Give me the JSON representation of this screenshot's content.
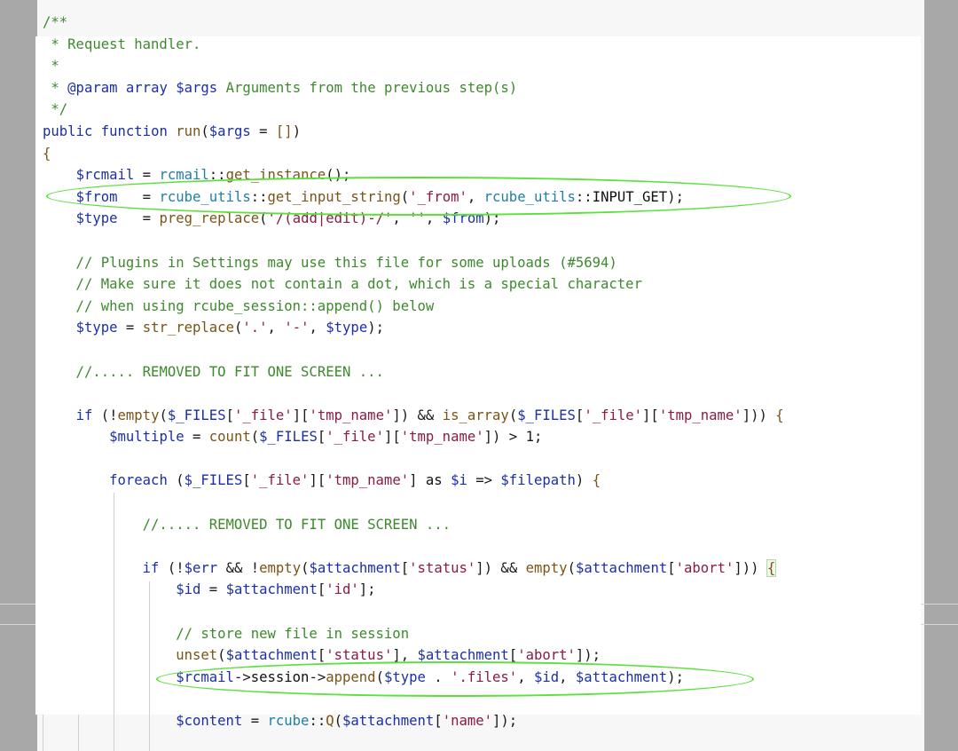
{
  "code_lines": [
    [
      [
        "c-cm",
        "/**"
      ]
    ],
    [
      [
        "c-cm",
        " * Request handler."
      ]
    ],
    [
      [
        "c-cm",
        " *"
      ]
    ],
    [
      [
        "c-cm",
        " * "
      ],
      [
        "c-kw",
        "@param"
      ],
      [
        "c-kw",
        " array"
      ],
      [
        "c-var",
        " $args"
      ],
      [
        "c-cm",
        " Arguments from the previous step(s)"
      ]
    ],
    [
      [
        "c-cm",
        " */"
      ]
    ],
    [
      [
        "c-kw",
        "public"
      ],
      [
        "c-p",
        " "
      ],
      [
        "c-kw",
        "function"
      ],
      [
        "c-p",
        " "
      ],
      [
        "c-fn",
        "run"
      ],
      [
        "c-p",
        "("
      ],
      [
        "c-var",
        "$args"
      ],
      [
        "c-p",
        " = "
      ],
      [
        "c-fn",
        "[]"
      ],
      [
        "c-p",
        ")"
      ]
    ],
    [
      [
        "c-fn",
        "{"
      ]
    ],
    [
      [
        "c-p",
        "    "
      ],
      [
        "c-var",
        "$rcmail"
      ],
      [
        "c-p",
        " = "
      ],
      [
        "c-cls",
        "rcmail"
      ],
      [
        "c-p",
        "::"
      ],
      [
        "c-fn",
        "get_instance"
      ],
      [
        "c-p",
        "();"
      ]
    ],
    [
      [
        "c-p",
        "    "
      ],
      [
        "c-var",
        "$from"
      ],
      [
        "c-p",
        "   = "
      ],
      [
        "c-cls",
        "rcube_utils"
      ],
      [
        "c-p",
        "::"
      ],
      [
        "c-fn",
        "get_input_string"
      ],
      [
        "c-p",
        "("
      ],
      [
        "c-str",
        "'_from'"
      ],
      [
        "c-p",
        ", "
      ],
      [
        "c-cls",
        "rcube_utils"
      ],
      [
        "c-p",
        "::"
      ],
      [
        "c-dark",
        "INPUT_GET"
      ],
      [
        "c-p",
        ");"
      ]
    ],
    [
      [
        "c-p",
        "    "
      ],
      [
        "c-var",
        "$type"
      ],
      [
        "c-p",
        "   = "
      ],
      [
        "c-fn",
        "preg_replace"
      ],
      [
        "c-p",
        "("
      ],
      [
        "c-str",
        "'/(add|edit)-/'"
      ],
      [
        "c-p",
        ", "
      ],
      [
        "c-str",
        "''"
      ],
      [
        "c-p",
        ", "
      ],
      [
        "c-var",
        "$from"
      ],
      [
        "c-p",
        ");"
      ]
    ],
    [
      [
        "c-p",
        ""
      ]
    ],
    [
      [
        "c-cm",
        "    // Plugins in Settings may use this file for some uploads (#5694)"
      ]
    ],
    [
      [
        "c-cm",
        "    // Make sure it does not contain a dot, which is a special character"
      ]
    ],
    [
      [
        "c-cm",
        "    // when using rcube_session::append() below"
      ]
    ],
    [
      [
        "c-p",
        "    "
      ],
      [
        "c-var",
        "$type"
      ],
      [
        "c-p",
        " = "
      ],
      [
        "c-fn",
        "str_replace"
      ],
      [
        "c-p",
        "("
      ],
      [
        "c-str",
        "'.'"
      ],
      [
        "c-p",
        ", "
      ],
      [
        "c-str",
        "'-'"
      ],
      [
        "c-p",
        ", "
      ],
      [
        "c-var",
        "$type"
      ],
      [
        "c-p",
        ");"
      ]
    ],
    [
      [
        "c-p",
        ""
      ]
    ],
    [
      [
        "c-cm",
        "    //..... "
      ],
      [
        "c-cm",
        "REMOVED TO FIT ONE SCREEN ..."
      ]
    ],
    [
      [
        "c-p",
        ""
      ]
    ],
    [
      [
        "c-p",
        "    "
      ],
      [
        "c-kw",
        "if"
      ],
      [
        "c-p",
        " (!"
      ],
      [
        "c-fn",
        "empty"
      ],
      [
        "c-p",
        "("
      ],
      [
        "c-var",
        "$_FILES"
      ],
      [
        "c-p",
        "["
      ],
      [
        "c-str",
        "'_file'"
      ],
      [
        "c-p",
        "]["
      ],
      [
        "c-str",
        "'tmp_name'"
      ],
      [
        "c-p",
        "]) && "
      ],
      [
        "c-fn",
        "is_array"
      ],
      [
        "c-p",
        "("
      ],
      [
        "c-var",
        "$_FILES"
      ],
      [
        "c-p",
        "["
      ],
      [
        "c-str",
        "'_file'"
      ],
      [
        "c-p",
        "]["
      ],
      [
        "c-str",
        "'tmp_name'"
      ],
      [
        "c-p",
        "])) "
      ],
      [
        "c-fn",
        "{"
      ]
    ],
    [
      [
        "c-p",
        "        "
      ],
      [
        "c-var",
        "$multiple"
      ],
      [
        "c-p",
        " = "
      ],
      [
        "c-fn",
        "count"
      ],
      [
        "c-p",
        "("
      ],
      [
        "c-var",
        "$_FILES"
      ],
      [
        "c-p",
        "["
      ],
      [
        "c-str",
        "'_file'"
      ],
      [
        "c-p",
        "]["
      ],
      [
        "c-str",
        "'tmp_name'"
      ],
      [
        "c-p",
        "]) > 1;"
      ]
    ],
    [
      [
        "c-p",
        ""
      ]
    ],
    [
      [
        "c-p",
        "        "
      ],
      [
        "c-kw",
        "foreach"
      ],
      [
        "c-p",
        " ("
      ],
      [
        "c-var",
        "$_FILES"
      ],
      [
        "c-p",
        "["
      ],
      [
        "c-str",
        "'_file'"
      ],
      [
        "c-p",
        "]["
      ],
      [
        "c-str",
        "'tmp_name'"
      ],
      [
        "c-p",
        "] "
      ],
      [
        "c-dark",
        "as"
      ],
      [
        "c-p",
        " "
      ],
      [
        "c-var",
        "$i"
      ],
      [
        "c-p",
        " => "
      ],
      [
        "c-var",
        "$filepath"
      ],
      [
        "c-p",
        ") "
      ],
      [
        "c-fn",
        "{"
      ]
    ],
    [
      [
        "c-p",
        ""
      ]
    ],
    [
      [
        "c-cm",
        "            //..... "
      ],
      [
        "c-cm",
        "REMOVED TO FIT ONE SCREEN ..."
      ]
    ],
    [
      [
        "c-p",
        ""
      ]
    ],
    [
      [
        "c-p",
        "            "
      ],
      [
        "c-kw",
        "if"
      ],
      [
        "c-p",
        " (!"
      ],
      [
        "c-var",
        "$err"
      ],
      [
        "c-p",
        " && !"
      ],
      [
        "c-fn",
        "empty"
      ],
      [
        "c-p",
        "("
      ],
      [
        "c-var",
        "$attachment"
      ],
      [
        "c-p",
        "["
      ],
      [
        "c-str",
        "'status'"
      ],
      [
        "c-p",
        "]) && "
      ],
      [
        "c-fn",
        "empty"
      ],
      [
        "c-p",
        "("
      ],
      [
        "c-var",
        "$attachment"
      ],
      [
        "c-p",
        "["
      ],
      [
        "c-str",
        "'abort'"
      ],
      [
        "c-p",
        "])) "
      ],
      [
        "c-fn bracket-box",
        "{"
      ]
    ],
    [
      [
        "c-p",
        "                "
      ],
      [
        "c-var",
        "$id"
      ],
      [
        "c-p",
        " = "
      ],
      [
        "c-var",
        "$attachment"
      ],
      [
        "c-p",
        "["
      ],
      [
        "c-str",
        "'id'"
      ],
      [
        "c-p",
        "];"
      ]
    ],
    [
      [
        "c-p",
        ""
      ]
    ],
    [
      [
        "c-cm",
        "                // store new file in session"
      ]
    ],
    [
      [
        "c-p",
        "                "
      ],
      [
        "c-fn",
        "unset"
      ],
      [
        "c-p",
        "("
      ],
      [
        "c-var",
        "$attachment"
      ],
      [
        "c-p",
        "["
      ],
      [
        "c-str",
        "'status'"
      ],
      [
        "c-p",
        "], "
      ],
      [
        "c-var",
        "$attachment"
      ],
      [
        "c-p",
        "["
      ],
      [
        "c-str",
        "'abort'"
      ],
      [
        "c-p",
        "]);"
      ]
    ],
    [
      [
        "c-p",
        "                "
      ],
      [
        "c-var",
        "$rcmail"
      ],
      [
        "c-p",
        "->"
      ],
      [
        "c-dark",
        "session"
      ],
      [
        "c-p",
        "->"
      ],
      [
        "c-fn",
        "append"
      ],
      [
        "c-p",
        "("
      ],
      [
        "c-var",
        "$type"
      ],
      [
        "c-p",
        " . "
      ],
      [
        "c-str",
        "'.files'"
      ],
      [
        "c-p",
        ", "
      ],
      [
        "c-var",
        "$id"
      ],
      [
        "c-p",
        ", "
      ],
      [
        "c-var",
        "$attachment"
      ],
      [
        "c-p",
        ");"
      ]
    ],
    [
      [
        "c-p",
        ""
      ]
    ],
    [
      [
        "c-p",
        "                "
      ],
      [
        "c-var",
        "$content"
      ],
      [
        "c-p",
        " = "
      ],
      [
        "c-cls",
        "rcube"
      ],
      [
        "c-p",
        "::"
      ],
      [
        "c-fn",
        "Q"
      ],
      [
        "c-p",
        "("
      ],
      [
        "c-var",
        "$attachment"
      ],
      [
        "c-p",
        "["
      ],
      [
        "c-str",
        "'name'"
      ],
      [
        "c-p",
        "]);"
      ]
    ]
  ],
  "highlight_color": "#5be13b"
}
